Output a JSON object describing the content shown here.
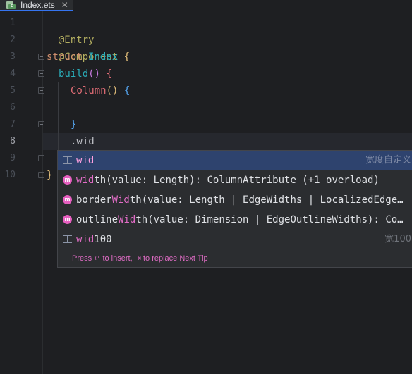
{
  "tab": {
    "filename": "Index.ets",
    "icon": "ets-file-icon",
    "close_glyph": "✕"
  },
  "gutter": {
    "line_numbers": [
      "1",
      "2",
      "3",
      "4",
      "5",
      "6",
      "7",
      "8",
      "9",
      "10"
    ],
    "active_line": "8"
  },
  "code": {
    "l1": "@Entry",
    "l2": "@Component",
    "l3_kw": "struct",
    "l3_type": "Index",
    "l3_brace": "{",
    "l4_fn": "build",
    "l4_paren": "()",
    "l4_brace": "{",
    "l5_fn": "Column",
    "l5_paren": "()",
    "l5_brace": "{",
    "l7_brace": "}",
    "l8_text": ".wid",
    "l10_brace": "}"
  },
  "completion": {
    "items": [
      {
        "icon": "template-icon",
        "prefix": "wid",
        "rest": "",
        "tail": "宽度自定义",
        "selected": true
      },
      {
        "icon": "method-icon",
        "pre": "",
        "match": "wid",
        "rest": "th(value: Length): ColumnAttribute (+1 overload)",
        "tail": ""
      },
      {
        "icon": "method-icon",
        "pre": "border",
        "match": "Wid",
        "rest": "th(value: Length | EdgeWidths | LocalizedEdge…",
        "tail": ""
      },
      {
        "icon": "method-icon",
        "pre": "outline",
        "match": "Wid",
        "rest": "th(value: Dimension | EdgeOutlineWidths): Co…",
        "tail": ""
      },
      {
        "icon": "template-icon",
        "pre": "",
        "match": "wid",
        "rest": "100",
        "tail": "宽100"
      }
    ],
    "footer": "Press ↵ to insert, ⇥ to replace  Next Tip"
  },
  "colors": {
    "background": "#1e1f22",
    "selection": "#2e436e",
    "match_highlight": "#e06cc5",
    "method_icon": "#e65fc0"
  }
}
